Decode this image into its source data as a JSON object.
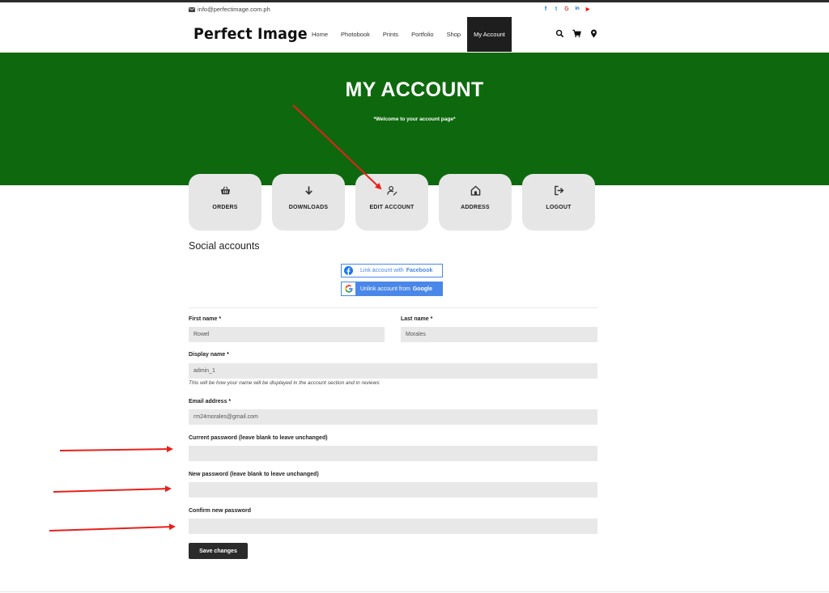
{
  "topbar": {
    "email": "info@perfectimage.com.ph",
    "socials": [
      {
        "icon": "facebook-icon",
        "glyph": "f",
        "color": "#1877f2"
      },
      {
        "icon": "twitter-icon",
        "glyph": "t",
        "color": "#1da1f2"
      },
      {
        "icon": "google-icon",
        "glyph": "G",
        "color": "#db4437"
      },
      {
        "icon": "linkedin-icon",
        "glyph": "in",
        "color": "#0a66c2"
      },
      {
        "icon": "youtube-icon",
        "glyph": "▶",
        "color": "#ff0000"
      }
    ]
  },
  "header": {
    "logo": "Perfect Image",
    "nav": [
      "Home",
      "Photobook",
      "Prints",
      "Portfolio",
      "Shop",
      "My Account"
    ],
    "active_nav": "My Account",
    "icons": [
      "search-icon",
      "cart-icon",
      "location-icon"
    ]
  },
  "hero": {
    "title": "MY ACCOUNT",
    "subtitle": "*Welcome to your account page*",
    "background": "#0e690e"
  },
  "account_menu": [
    {
      "label": "ORDERS",
      "icon": "basket-icon"
    },
    {
      "label": "DOWNLOADS",
      "icon": "download-arrow-icon"
    },
    {
      "label": "EDIT ACCOUNT",
      "icon": "user-edit-icon"
    },
    {
      "label": "ADDRESS",
      "icon": "home-icon"
    },
    {
      "label": "LOGOUT",
      "icon": "logout-icon"
    }
  ],
  "social_accounts": {
    "title": "Social accounts",
    "facebook_prefix": "Link account with",
    "facebook_brand": "Facebook",
    "google_prefix": "Unlink account from",
    "google_brand": "Google"
  },
  "form": {
    "first_name_label": "First name *",
    "first_name_value": "Rowel",
    "last_name_label": "Last name *",
    "last_name_value": "Morales",
    "display_name_label": "Display name *",
    "display_name_value": "admin_1",
    "display_name_hint": "This will be how your name will be displayed in the account section and in reviews",
    "email_label": "Email address *",
    "email_value": "rm24morales@gmail.com",
    "current_password_label": "Current password (leave blank to leave unchanged)",
    "new_password_label": "New password (leave blank to leave unchanged)",
    "confirm_password_label": "Confirm new password",
    "save_label": "Save changes"
  },
  "annotation_color": "#e8201a"
}
